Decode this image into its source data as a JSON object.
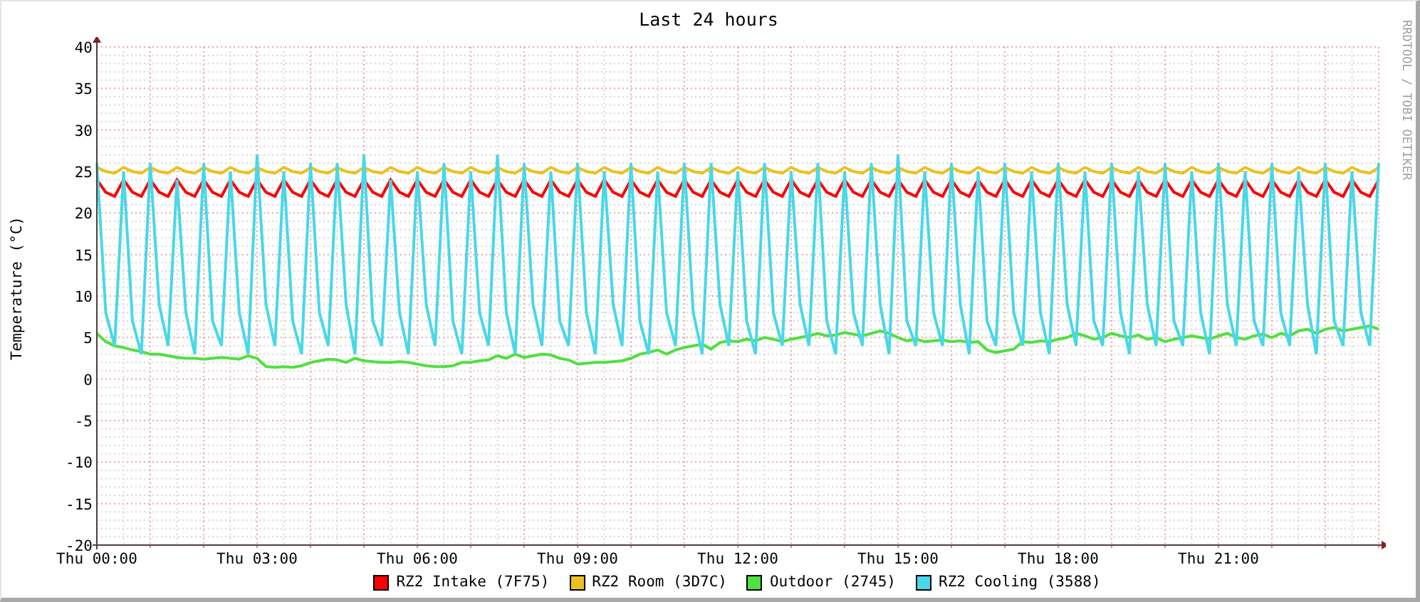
{
  "watermark": "RRDTOOL / TOBI OETIKER",
  "chart_data": {
    "type": "line",
    "title": "Last 24 hours",
    "ylabel": "Temperature (°C)",
    "ylim": [
      -20,
      40
    ],
    "grid": true,
    "yticks": [
      -20,
      -15,
      -10,
      -5,
      0,
      5,
      10,
      15,
      20,
      25,
      30,
      35,
      40
    ],
    "categories": [
      "Thu 00:00",
      null,
      null,
      null,
      null,
      null,
      null,
      null,
      null,
      null,
      null,
      null,
      null,
      null,
      null,
      null,
      null,
      null,
      "Thu 03:00",
      null,
      null,
      null,
      null,
      null,
      null,
      null,
      null,
      null,
      null,
      null,
      null,
      null,
      null,
      null,
      null,
      null,
      "Thu 06:00",
      null,
      null,
      null,
      null,
      null,
      null,
      null,
      null,
      null,
      null,
      null,
      null,
      null,
      null,
      null,
      null,
      null,
      "Thu 09:00",
      null,
      null,
      null,
      null,
      null,
      null,
      null,
      null,
      null,
      null,
      null,
      null,
      null,
      null,
      null,
      null,
      null,
      "Thu 12:00",
      null,
      null,
      null,
      null,
      null,
      null,
      null,
      null,
      null,
      null,
      null,
      null,
      null,
      null,
      null,
      null,
      null,
      "Thu 15:00",
      null,
      null,
      null,
      null,
      null,
      null,
      null,
      null,
      null,
      null,
      null,
      null,
      null,
      null,
      null,
      null,
      null,
      "Thu 18:00",
      null,
      null,
      null,
      null,
      null,
      null,
      null,
      null,
      null,
      null,
      null,
      null,
      null,
      null,
      null,
      null,
      null,
      "Thu 21:00",
      null,
      null,
      null,
      null,
      null,
      null,
      null,
      null,
      null,
      null,
      null,
      null,
      null,
      null,
      null,
      null,
      null,
      null
    ],
    "series": [
      {
        "name": "RZ2 Intake (7F75)",
        "color": "#ff0000",
        "values": [
          24,
          22.5,
          22,
          24,
          22.5,
          22,
          24,
          22.5,
          22,
          24,
          22.5,
          22,
          24,
          22.5,
          22,
          24,
          22.5,
          22,
          24,
          22.5,
          22,
          24,
          22.5,
          22,
          24,
          22.5,
          22,
          24,
          22.5,
          22,
          24,
          22.5,
          22,
          24,
          22.5,
          22,
          24,
          22.5,
          22,
          24,
          22.5,
          22,
          24,
          22.5,
          22,
          24,
          22.5,
          22,
          24,
          22.5,
          22,
          24,
          22.5,
          22,
          24,
          22.5,
          22,
          24,
          22.5,
          22,
          24,
          22.5,
          22,
          24,
          22.5,
          22,
          24,
          22.5,
          22,
          24,
          22.5,
          22,
          24,
          22.5,
          22,
          24,
          22.5,
          22,
          24,
          22.5,
          22,
          24,
          22.5,
          22,
          24,
          22.5,
          22,
          24,
          22.5,
          22,
          24,
          22.5,
          22,
          24,
          22.5,
          22,
          24,
          22.5,
          22,
          24,
          22.5,
          22,
          24,
          22.5,
          22,
          24,
          22.5,
          22,
          24,
          22.5,
          22,
          24,
          22.5,
          22,
          24,
          22.5,
          22,
          24,
          22.5,
          22,
          24,
          22.5,
          22,
          24,
          22.5,
          22,
          24,
          22.5,
          22,
          24,
          22.5,
          22,
          24,
          22.5,
          22,
          24,
          22.5,
          22,
          24,
          22.5,
          22,
          24,
          22.5,
          22,
          24
        ]
      },
      {
        "name": "RZ2 Room (3D7C)",
        "color": "#ecc020",
        "values": [
          25.5,
          25,
          24.8,
          25.5,
          25,
          24.8,
          25.5,
          25,
          24.8,
          25.5,
          25,
          24.8,
          25.5,
          25,
          24.8,
          25.5,
          25,
          24.8,
          25.5,
          25,
          24.8,
          25.5,
          25,
          24.8,
          25.5,
          25,
          24.8,
          25.5,
          25,
          24.8,
          25.5,
          25,
          24.8,
          25.5,
          25,
          24.8,
          25.5,
          25,
          24.8,
          25.5,
          25,
          24.8,
          25.5,
          25,
          24.8,
          25.5,
          25,
          24.8,
          25.5,
          25,
          24.8,
          25.5,
          25,
          24.8,
          25.5,
          25,
          24.8,
          25.5,
          25,
          24.8,
          25.5,
          25,
          24.8,
          25.5,
          25,
          24.8,
          25.5,
          25,
          24.8,
          25.5,
          25,
          24.8,
          25.5,
          25,
          24.8,
          25.5,
          25,
          24.8,
          25.5,
          25,
          24.8,
          25.5,
          25,
          24.8,
          25.5,
          25,
          24.8,
          25.5,
          25,
          24.8,
          25.5,
          25,
          24.8,
          25.5,
          25,
          24.8,
          25.5,
          25,
          24.8,
          25.5,
          25,
          24.8,
          25.5,
          25,
          24.8,
          25.5,
          25,
          24.8,
          25.5,
          25,
          24.8,
          25.5,
          25,
          24.8,
          25.5,
          25,
          24.8,
          25.5,
          25,
          24.8,
          25.5,
          25,
          24.8,
          25.5,
          25,
          24.8,
          25.5,
          25,
          24.8,
          25.5,
          25,
          24.8,
          25.5,
          25,
          24.8,
          25.5,
          25,
          24.8,
          25.5,
          25,
          24.8,
          25.5,
          25,
          24.8,
          25.5
        ]
      },
      {
        "name": "Outdoor (2745)",
        "color": "#50e040",
        "values": [
          5.5,
          4.5,
          4,
          3.8,
          3.5,
          3.3,
          3,
          3,
          2.8,
          2.6,
          2.5,
          2.5,
          2.4,
          2.5,
          2.6,
          2.5,
          2.4,
          2.8,
          2.5,
          1.5,
          1.4,
          1.5,
          1.4,
          1.6,
          2,
          2.2,
          2.4,
          2.3,
          2,
          2.5,
          2.2,
          2.1,
          2,
          2,
          2.1,
          2,
          1.8,
          1.6,
          1.5,
          1.5,
          1.6,
          2,
          2,
          2.2,
          2.3,
          2.8,
          2.5,
          3,
          2.6,
          2.8,
          3,
          2.9,
          2.5,
          2.3,
          1.8,
          1.9,
          2,
          2,
          2.1,
          2.2,
          2.5,
          3,
          3.2,
          3.5,
          3,
          3.5,
          3.8,
          4,
          4.2,
          3.6,
          4.4,
          4.6,
          4.5,
          4.8,
          4.6,
          5,
          4.8,
          4.5,
          4.8,
          5,
          5.2,
          5.5,
          5.2,
          5.3,
          5.6,
          5.4,
          5.2,
          5.5,
          5.8,
          5.5,
          5,
          4.6,
          4.8,
          4.5,
          4.6,
          4.7,
          4.5,
          4.6,
          4.4,
          4.5,
          3.5,
          3.2,
          3.4,
          3.6,
          4.5,
          4.4,
          4.6,
          4.5,
          4.8,
          5,
          5.5,
          5.2,
          4.8,
          5,
          5.5,
          5.2,
          5,
          5.3,
          4.8,
          5,
          4.5,
          4.8,
          5,
          5.2,
          5,
          4.8,
          5.2,
          5.5,
          5,
          4.8,
          5.2,
          5.4,
          5,
          5.5,
          5.2,
          5.8,
          6,
          5.5,
          6,
          6.2,
          5.8,
          6,
          6.2,
          6.4,
          6
        ]
      },
      {
        "name": "RZ2 Cooling (3588)",
        "color": "#48d8e8",
        "values": [
          26,
          8,
          4,
          25,
          7,
          3,
          26,
          9,
          4,
          24,
          8,
          3,
          26,
          7,
          4,
          25,
          8,
          3,
          27,
          9,
          4,
          25,
          7,
          3,
          26,
          8,
          4,
          26,
          9,
          3,
          27,
          7,
          4,
          24,
          8,
          3,
          25,
          9,
          4,
          26,
          7,
          3,
          25,
          8,
          4,
          27,
          8,
          3,
          26,
          9,
          4,
          25,
          7,
          4,
          26,
          8,
          3,
          25,
          9,
          4,
          26,
          7,
          3,
          25,
          8,
          4,
          26,
          8,
          3,
          26,
          9,
          4,
          25,
          7,
          3,
          26,
          8,
          4,
          25,
          9,
          4,
          26,
          7,
          3,
          25,
          8,
          4,
          26,
          9,
          3,
          27,
          7,
          4,
          25,
          8,
          4,
          26,
          9,
          3,
          25,
          7,
          4,
          26,
          8,
          4,
          25,
          8,
          3,
          26,
          9,
          4,
          25,
          7,
          4,
          26,
          8,
          3,
          25,
          9,
          4,
          26,
          7,
          4,
          25,
          8,
          3,
          26,
          9,
          4,
          25,
          7,
          4,
          26,
          8,
          4,
          25,
          9,
          3,
          26,
          7,
          4,
          25,
          8,
          4,
          26
        ]
      }
    ]
  }
}
